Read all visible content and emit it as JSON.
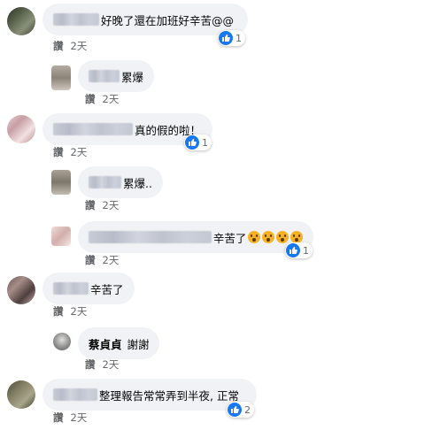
{
  "comments": [
    {
      "text": "好晚了還在加班好辛苦@@",
      "likes": "1",
      "like_label": "讚",
      "time": "2天",
      "avatar_color": "#3f4a37"
    },
    {
      "text": "累爆",
      "like_label": "讚",
      "time": "2天",
      "avatar_color": "#9d958b"
    },
    {
      "text": "真的假的啦！",
      "likes": "1",
      "like_label": "讚",
      "time": "2天",
      "avatar_color": "#c9a6aa"
    },
    {
      "text": "累爆..",
      "like_label": "讚",
      "time": "2天",
      "avatar_color": "#8a8378"
    },
    {
      "text": "辛苦了",
      "emoji_count": 4,
      "likes": "1",
      "like_label": "讚",
      "time": "2天",
      "avatar_color": "#d9b7b4"
    },
    {
      "text": "辛苦了",
      "like_label": "讚",
      "time": "2天",
      "avatar_color": "#806a66"
    },
    {
      "name": "蔡貞貞",
      "text": "謝謝",
      "like_label": "讚",
      "time": "2天",
      "avatar_color": "#9a9a98"
    },
    {
      "text": "整理報告常常弄到半夜, 正常",
      "likes": "2",
      "like_label": "讚",
      "time": "2天",
      "avatar_color": "#6d6b53"
    }
  ],
  "colors": {
    "bubble": "#f0f2f5",
    "like_blue": "#1877f2",
    "meta": "#65676b"
  }
}
